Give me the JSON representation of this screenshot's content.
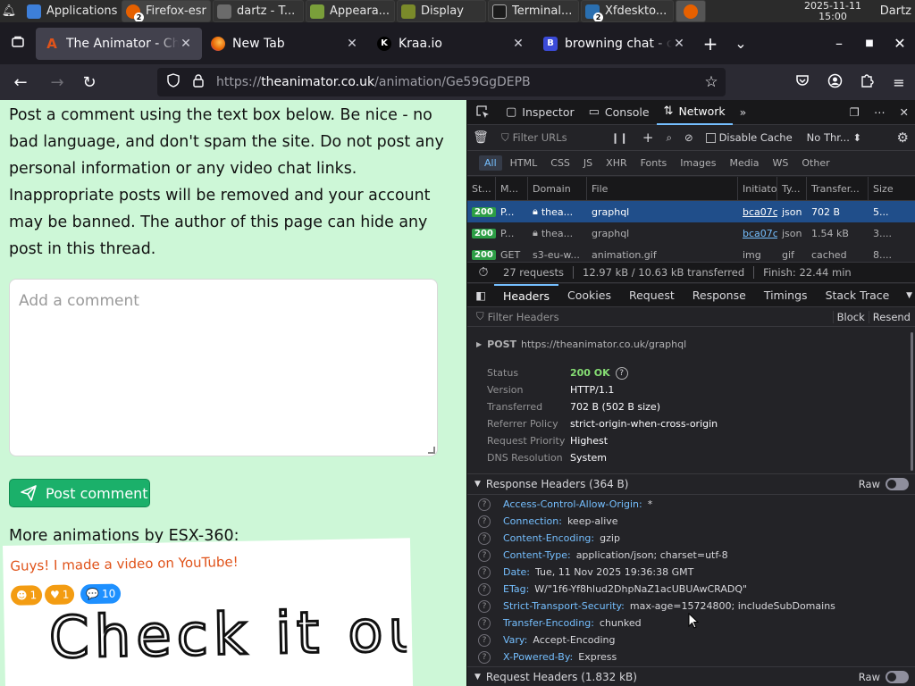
{
  "taskbar": {
    "apps": [
      {
        "label": "Applications",
        "icon": "xfce-mouse-icon",
        "color": "#3d7fd9"
      },
      {
        "label": "Firefox-esr",
        "icon": "firefox-icon",
        "color": "#e66000",
        "badge": "2"
      },
      {
        "label": "dartz - T...",
        "icon": "folder-icon",
        "color": "#6b6b6b"
      },
      {
        "label": "Appeara...",
        "icon": "appearance-icon",
        "color": "#7a9f3a"
      },
      {
        "label": "Display",
        "icon": "display-icon",
        "color": "#7a8a2a"
      },
      {
        "label": "Terminal...",
        "icon": "terminal-icon",
        "color": "#444"
      },
      {
        "label": "Xfdeskto...",
        "icon": "xfdesktop-icon",
        "color": "#2a6fb0",
        "badge": "2"
      },
      {
        "label": "",
        "icon": "firefox-icon",
        "color": "#e66000"
      }
    ],
    "clock_date": "2025-11-11",
    "clock_time": "15:00",
    "user": "Dartz"
  },
  "tabs": [
    {
      "label": "The Animator - Chro",
      "icon": "A",
      "icon_color": "#e0531a",
      "active": true
    },
    {
      "label": "New Tab",
      "icon": "firefox",
      "icon_color": "#e66000",
      "active": false
    },
    {
      "label": "Kraa.io",
      "icon": "K",
      "icon_color": "#000",
      "active": false
    },
    {
      "label": "browning chat - cha",
      "icon": "B",
      "icon_color": "#3b4bd8",
      "active": false
    }
  ],
  "url": {
    "scheme": "https://",
    "host": "theanimator.co.uk",
    "path": "/animation/Ge59GgDEPB"
  },
  "page": {
    "notice": "Post a comment using the text box below. Be nice - no bad language, and don't spam the site. Do not post any personal information or any video chat links. Inappropriate posts will be removed and your account may be banned. The author of this page can hide any post in this thread.",
    "comment_placeholder": "Add a comment",
    "post_button": "Post comment",
    "more_heading": "More animations by ESX-360:",
    "thumb_title": "Guys! I made a video on YouTube!",
    "thumb_counts": {
      "face": "1",
      "heart": "1",
      "comments": "10"
    },
    "thumb_drawing_text": "Check it out"
  },
  "devtools": {
    "tabs": [
      "Inspector",
      "Console",
      "Network"
    ],
    "active_tab": "Network",
    "filter_placeholder": "Filter URLs",
    "disable_cache": "Disable Cache",
    "throttle": "No Thr...",
    "type_filters": [
      "All",
      "HTML",
      "CSS",
      "JS",
      "XHR",
      "Fonts",
      "Images",
      "Media",
      "WS",
      "Other"
    ],
    "columns": [
      "St...",
      "M...",
      "Domain",
      "File",
      "Initiator",
      "Ty...",
      "Transfer...",
      "Size"
    ],
    "requests": [
      {
        "status": "200",
        "method": "P...",
        "domain": "thea...",
        "file": "graphql",
        "initiator": "bca07c...",
        "type": "json",
        "transferred": "702 B",
        "size": "5...",
        "selected": true,
        "lock": true
      },
      {
        "status": "200",
        "method": "P...",
        "domain": "thea...",
        "file": "graphql",
        "initiator": "bca07c...",
        "type": "json",
        "transferred": "1.54 kB",
        "size": "3....",
        "selected": false,
        "lock": true
      },
      {
        "status": "200",
        "method": "GET",
        "domain": "s3-eu-w...",
        "file": "animation.gif",
        "initiator": "img",
        "type": "gif",
        "transferred": "cached",
        "size": "8....",
        "selected": false,
        "lock": false
      }
    ],
    "summary": {
      "requests": "27 requests",
      "transferred": "12.97 kB / 10.63 kB transferred",
      "finish": "Finish: 22.44 min"
    },
    "detail_tabs": [
      "Headers",
      "Cookies",
      "Request",
      "Response",
      "Timings",
      "Stack Trace"
    ],
    "filter_headers": "Filter Headers",
    "block": "Block",
    "resend": "Resend",
    "post_line": {
      "method": "POST",
      "url": "https://theanimator.co.uk/graphql"
    },
    "general": [
      {
        "key": "Status",
        "value": "200 OK"
      },
      {
        "key": "Version",
        "value": "HTTP/1.1"
      },
      {
        "key": "Transferred",
        "value": "702 B (502 B size)"
      },
      {
        "key": "Referrer Policy",
        "value": "strict-origin-when-cross-origin"
      },
      {
        "key": "Request Priority",
        "value": "Highest"
      },
      {
        "key": "DNS Resolution",
        "value": "System"
      }
    ],
    "response_headers_title": "Response Headers (364 B)",
    "raw_label": "Raw",
    "response_headers": [
      {
        "key": "Access-Control-Allow-Origin:",
        "value": "*"
      },
      {
        "key": "Connection:",
        "value": "keep-alive"
      },
      {
        "key": "Content-Encoding:",
        "value": "gzip"
      },
      {
        "key": "Content-Type:",
        "value": "application/json; charset=utf-8"
      },
      {
        "key": "Date:",
        "value": "Tue, 11 Nov 2025 19:36:38 GMT"
      },
      {
        "key": "ETag:",
        "value": "W/\"1f6-Yf8hlud2DhpNaZ1acUBUAwCRADQ\""
      },
      {
        "key": "Strict-Transport-Security:",
        "value": "max-age=15724800; includeSubDomains"
      },
      {
        "key": "Transfer-Encoding:",
        "value": "chunked"
      },
      {
        "key": "Vary:",
        "value": "Accept-Encoding"
      },
      {
        "key": "X-Powered-By:",
        "value": "Express"
      }
    ],
    "request_headers_title": "Request Headers (1.832 kB)"
  }
}
